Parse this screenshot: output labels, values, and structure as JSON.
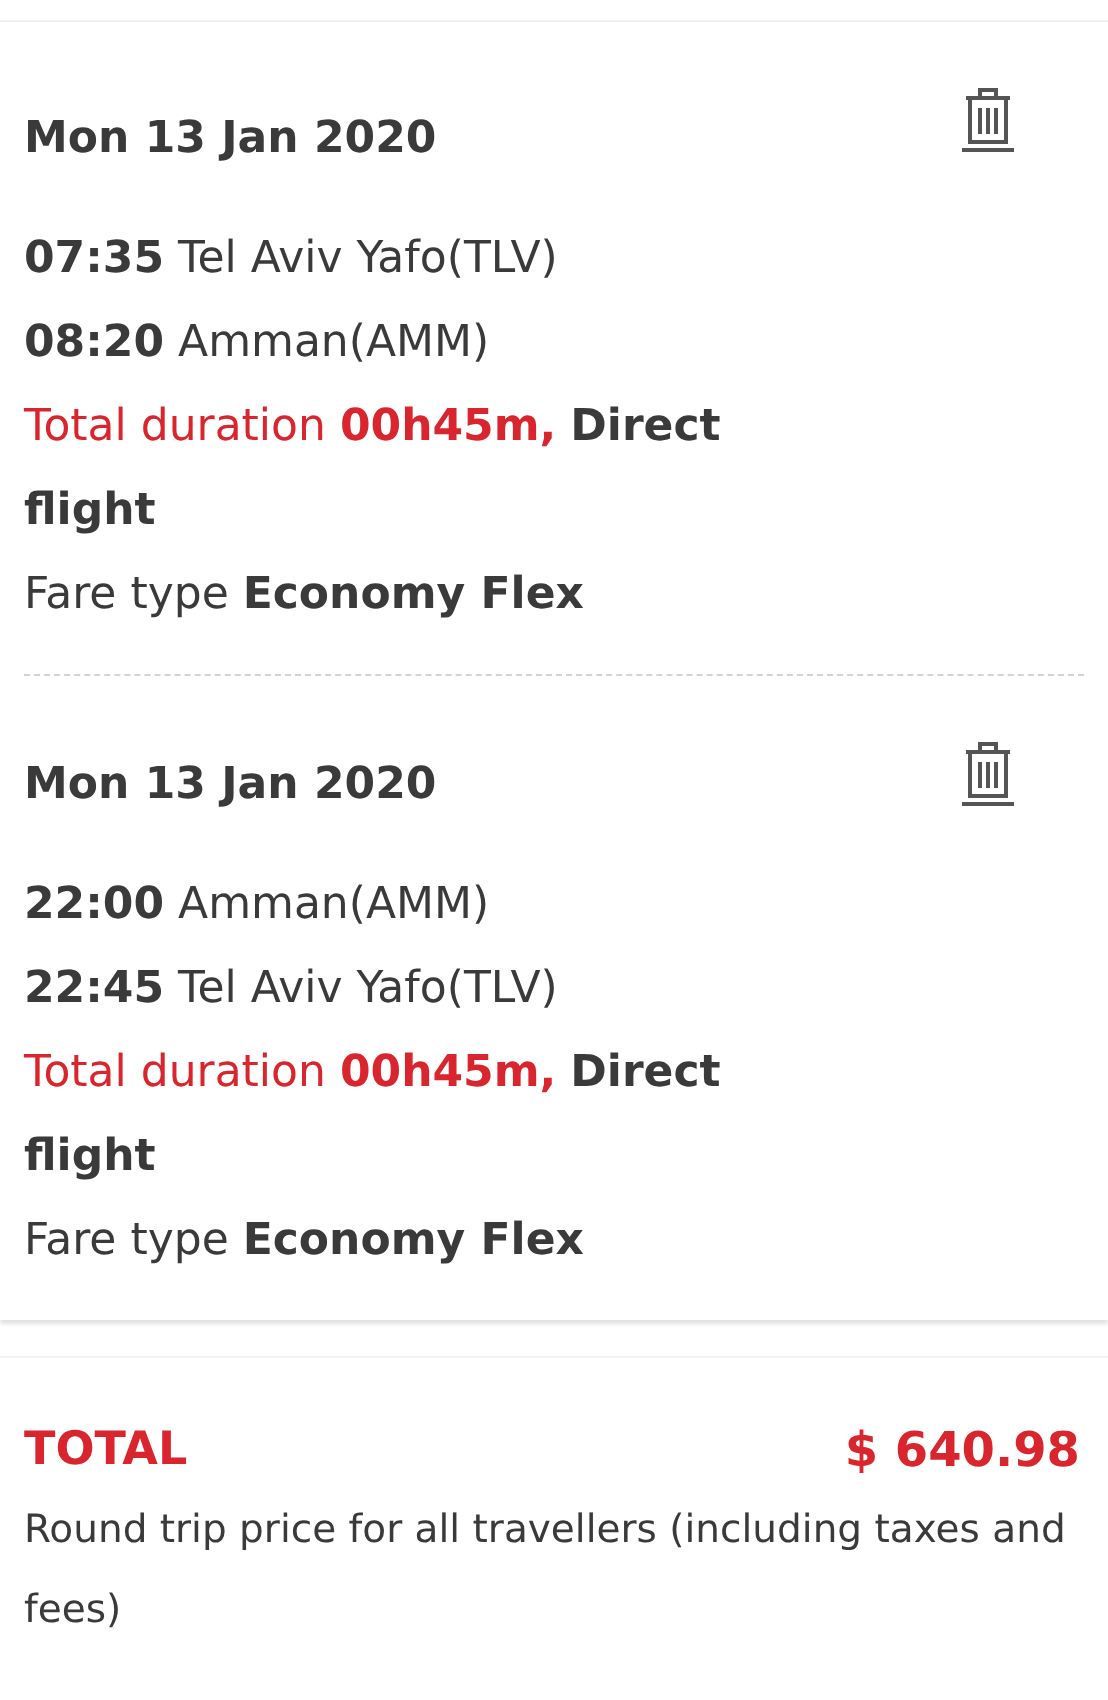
{
  "flights": [
    {
      "date": "Mon 13 Jan 2020",
      "departure": {
        "time": "07:35",
        "place": "Tel Aviv Yafo(TLV)"
      },
      "arrival": {
        "time": "08:20",
        "place": "Amman(AMM)"
      },
      "duration": {
        "label": "Total duration",
        "value": "00h45m,",
        "note": "Direct flight"
      },
      "fare": {
        "label": "Fare type",
        "value": "Economy Flex"
      }
    },
    {
      "date": "Mon 13 Jan 2020",
      "departure": {
        "time": "22:00",
        "place": "Amman(AMM)"
      },
      "arrival": {
        "time": "22:45",
        "place": "Tel Aviv Yafo(TLV)"
      },
      "duration": {
        "label": "Total duration",
        "value": "00h45m,",
        "note": "Direct flight"
      },
      "fare": {
        "label": "Fare type",
        "value": "Economy Flex"
      }
    }
  ],
  "total": {
    "label": "TOTAL",
    "amount": "$ 640.98",
    "note": "Round trip price for all travellers (including taxes and fees)"
  }
}
